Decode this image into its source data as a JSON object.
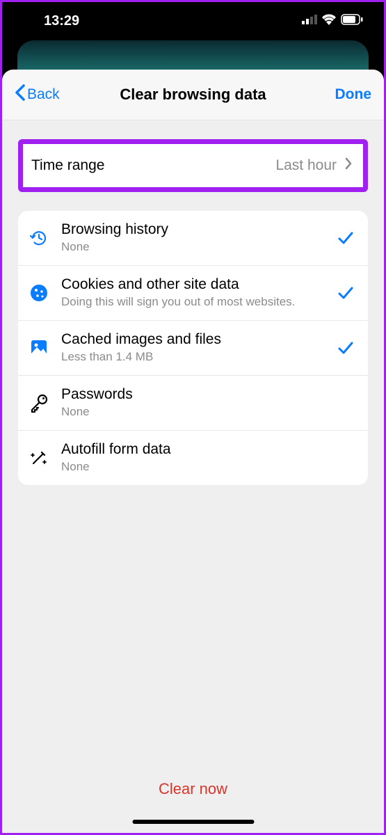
{
  "status": {
    "time": "13:29"
  },
  "nav": {
    "back": "Back",
    "title": "Clear browsing data",
    "done": "Done"
  },
  "time_range": {
    "label": "Time range",
    "value": "Last hour"
  },
  "items": [
    {
      "icon": "history",
      "title": "Browsing history",
      "sub": "None",
      "checked": true
    },
    {
      "icon": "cookie",
      "title": "Cookies and other site data",
      "sub": "Doing this will sign you out of most websites.",
      "checked": true
    },
    {
      "icon": "image",
      "title": "Cached images and files",
      "sub": "Less than 1.4 MB",
      "checked": true
    },
    {
      "icon": "key",
      "title": "Passwords",
      "sub": "None",
      "checked": false
    },
    {
      "icon": "wand",
      "title": "Autofill form data",
      "sub": "None",
      "checked": false
    }
  ],
  "footer": {
    "clear": "Clear now"
  },
  "colors": {
    "accent": "#0a7cff",
    "danger": "#d9362a",
    "highlight": "#a020f0"
  }
}
